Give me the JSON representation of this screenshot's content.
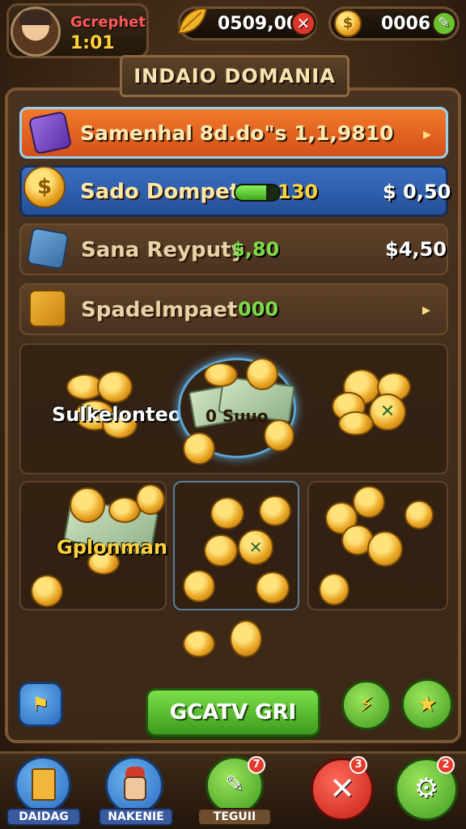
{
  "hud": {
    "player_name": "Gcrephet",
    "player_time": "1:01",
    "gems_value": "0509,00",
    "coins_value": "0006"
  },
  "panel": {
    "title": "INDAIO DOMANIA"
  },
  "rows": [
    {
      "label": "Samenhal 8d.do\"s 1,1,9810"
    },
    {
      "label": "Sado Dompet",
      "bar_value": "130",
      "price": "$ 0,50",
      "progress": 0.7
    },
    {
      "label": "Sana Reyputy",
      "mid_value": "$,80",
      "price": "$4,50"
    },
    {
      "label": "Spadelmpaet",
      "mid_value": "000"
    }
  ],
  "grid": {
    "cell1_label": "Sulkelonteo",
    "cell2_label": "0  Suuo",
    "cell4_label": "Gplonman"
  },
  "actions": {
    "main_button": "GCATV GRI"
  },
  "nav": [
    {
      "label": "DAIDAG"
    },
    {
      "label": "NAKENIE"
    },
    {
      "label": "TEGUII",
      "badge": "7"
    },
    {
      "label": "",
      "badge": "3"
    },
    {
      "label": "",
      "badge": "2"
    }
  ],
  "colors": {
    "row_orange": "#e8621c",
    "row_blue": "#2a5aa8",
    "progress_green": "#5fd33a",
    "main_button_green": "#58b52c",
    "close_red": "#e0352a"
  }
}
